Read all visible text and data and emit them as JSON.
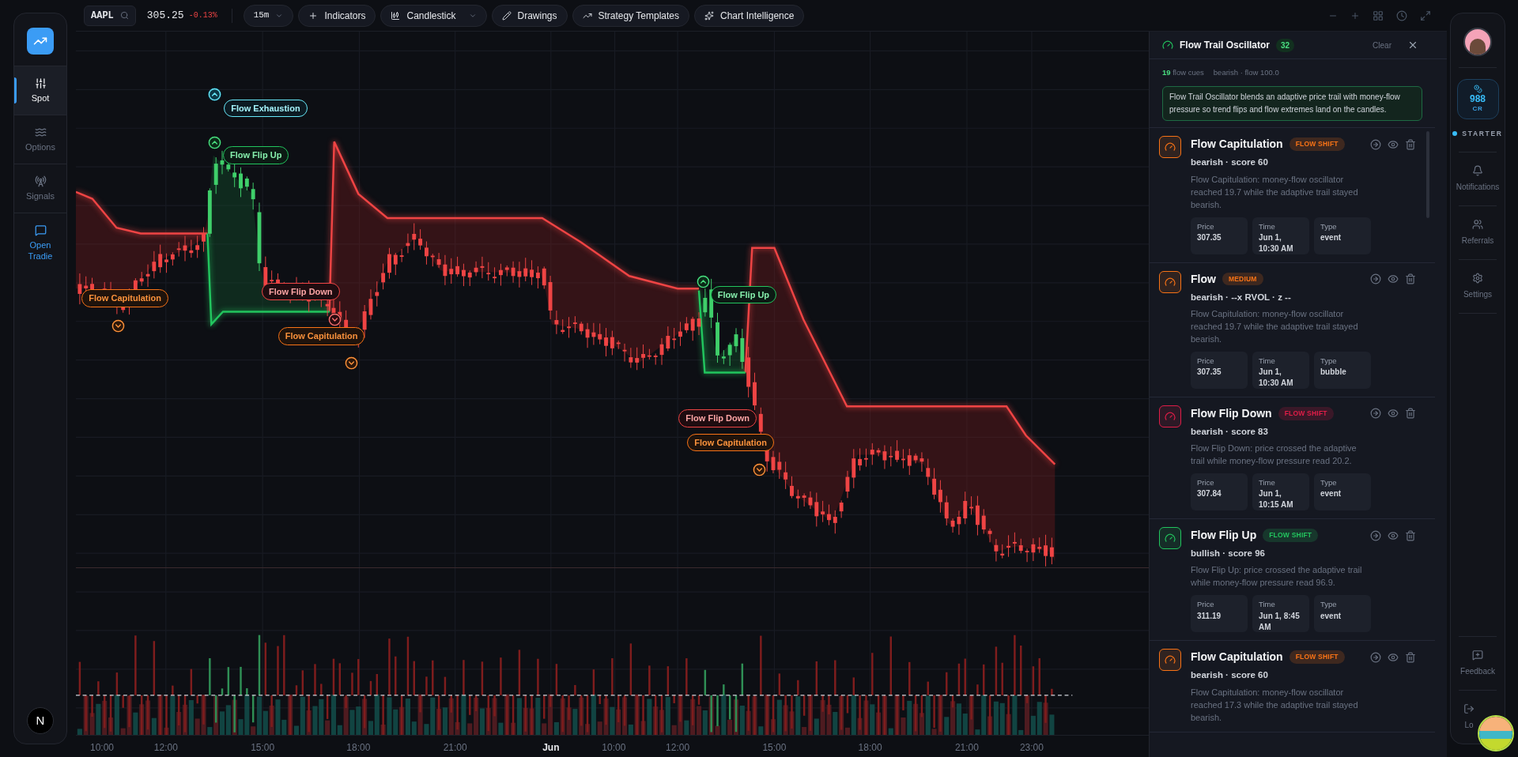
{
  "left_rail": {
    "items": [
      {
        "label": "Spot",
        "selected": true,
        "kind": "nav"
      },
      {
        "label": "Options",
        "selected": false,
        "kind": "nav"
      },
      {
        "label": "Signals",
        "selected": false,
        "kind": "nav"
      },
      {
        "label": "Open Tradie",
        "selected": false,
        "kind": "action"
      }
    ],
    "footer_badge": "N"
  },
  "toolbar": {
    "symbol": "AAPL",
    "price": "305.25",
    "change": "-0.13%",
    "timeframe": "15m",
    "buttons": [
      {
        "label": "Indicators",
        "dropdown": false
      },
      {
        "label": "Candlestick",
        "dropdown": true
      },
      {
        "label": "Drawings",
        "dropdown": false
      },
      {
        "label": "Strategy Templates",
        "dropdown": false
      },
      {
        "label": "Chart Intelligence",
        "dropdown": false
      }
    ]
  },
  "chart": {
    "markers": [
      {
        "label": "Flow Exhaustion",
        "kind": "exhaustion"
      },
      {
        "label": "Flow Flip Up",
        "kind": "flip_up"
      },
      {
        "label": "Flow Capitulation",
        "kind": "capitulation"
      },
      {
        "label": "Flow Flip Down",
        "kind": "flip_down"
      },
      {
        "label": "Flow Capitulation",
        "kind": "capitulation"
      },
      {
        "label": "Flow Flip Up",
        "kind": "flip_up"
      },
      {
        "label": "Flow Flip Down",
        "kind": "flip_down"
      },
      {
        "label": "Flow Capitulation",
        "kind": "capitulation"
      }
    ],
    "time_axis": [
      {
        "label": "10:00",
        "bold": false
      },
      {
        "label": "12:00",
        "bold": false
      },
      {
        "label": "15:00",
        "bold": false
      },
      {
        "label": "18:00",
        "bold": false
      },
      {
        "label": "21:00",
        "bold": false
      },
      {
        "label": "Jun",
        "bold": true
      },
      {
        "label": "10:00",
        "bold": false
      },
      {
        "label": "12:00",
        "bold": false
      },
      {
        "label": "15:00",
        "bold": false
      },
      {
        "label": "18:00",
        "bold": false
      },
      {
        "label": "21:00",
        "bold": false
      },
      {
        "label": "23:00",
        "bold": false
      }
    ]
  },
  "panel": {
    "title": "Flow Trail Oscillator",
    "count": "32",
    "clear": "Clear",
    "cue_count": "19",
    "cue_label": "flow cues",
    "bias": "bearish · flow 100.0",
    "description": "Flow Trail Oscillator blends an adaptive price trail with money-flow pressure so trend flips and flow extremes land on the candles.",
    "cards": [
      {
        "title": "Flow Capitulation",
        "badge": "FLOW SHIFT",
        "color": "#f97316",
        "meta": "bearish · score 60",
        "text": "Flow Capitulation: money-flow oscillator reached 19.7 while the adaptive trail stayed bearish.",
        "stats": [
          {
            "label": "Price",
            "value": "307.35"
          },
          {
            "label": "Time",
            "value": "Jun 1, 10:30 AM"
          },
          {
            "label": "Type",
            "value": "event"
          }
        ]
      },
      {
        "title": "Flow",
        "badge": "MEDIUM",
        "color": "#f97316",
        "meta": "bearish · --x RVOL · z --",
        "text": "Flow Capitulation: money-flow oscillator reached 19.7 while the adaptive trail stayed bearish.",
        "stats": [
          {
            "label": "Price",
            "value": "307.35"
          },
          {
            "label": "Time",
            "value": "Jun 1, 10:30 AM"
          },
          {
            "label": "Type",
            "value": "bubble"
          }
        ]
      },
      {
        "title": "Flow Flip Down",
        "badge": "FLOW SHIFT",
        "color": "#e11d48",
        "meta": "bearish · score 83",
        "text": "Flow Flip Down: price crossed the adaptive trail while money-flow pressure read 20.2.",
        "stats": [
          {
            "label": "Price",
            "value": "307.84"
          },
          {
            "label": "Time",
            "value": "Jun 1, 10:15 AM"
          },
          {
            "label": "Type",
            "value": "event"
          }
        ]
      },
      {
        "title": "Flow Flip Up",
        "badge": "FLOW SHIFT",
        "color": "#22c55e",
        "meta": "bullish · score 96",
        "text": "Flow Flip Up: price crossed the adaptive trail while money-flow pressure read 96.9.",
        "stats": [
          {
            "label": "Price",
            "value": "311.19"
          },
          {
            "label": "Time",
            "value": "Jun 1, 8:45 AM"
          },
          {
            "label": "Type",
            "value": "event"
          }
        ]
      },
      {
        "title": "Flow Capitulation",
        "badge": "FLOW SHIFT",
        "color": "#f97316",
        "meta": "bearish · score 60",
        "text": "Flow Capitulation: money-flow oscillator reached 17.3 while the adaptive trail stayed bearish."
      }
    ]
  },
  "right_rail": {
    "credits": "988",
    "credits_unit": "CR",
    "plan": "STARTER",
    "top_items": [
      {
        "label": "Notifications"
      },
      {
        "label": "Referrals"
      },
      {
        "label": "Settings"
      }
    ],
    "bottom_items": [
      {
        "label": "Feedback"
      },
      {
        "label": "Lo"
      }
    ]
  }
}
